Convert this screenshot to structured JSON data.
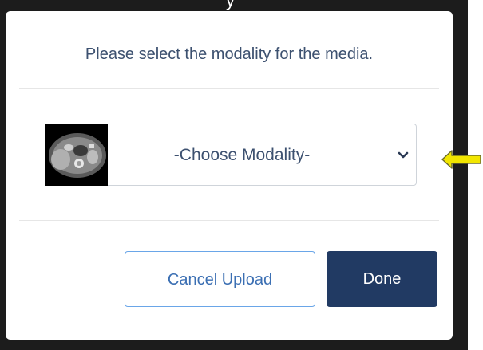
{
  "top_text_fragment": "y",
  "dialog": {
    "title": "Please select the modality for the media.",
    "select": {
      "selected_value": "-Choose Modality-",
      "thumbnail_icon": "ct-scan-thumbnail",
      "dropdown_icon": "chevron-down-icon"
    },
    "buttons": {
      "cancel_label": "Cancel Upload",
      "done_label": "Done"
    }
  },
  "annotation": {
    "arrow_icon": "left-arrow-icon",
    "arrow_color": "#f2e600"
  },
  "colors": {
    "text": "#3d5170",
    "done_bg": "#213a63",
    "cancel_border": "#6aa6e8",
    "backdrop": "#1c1c1c"
  }
}
